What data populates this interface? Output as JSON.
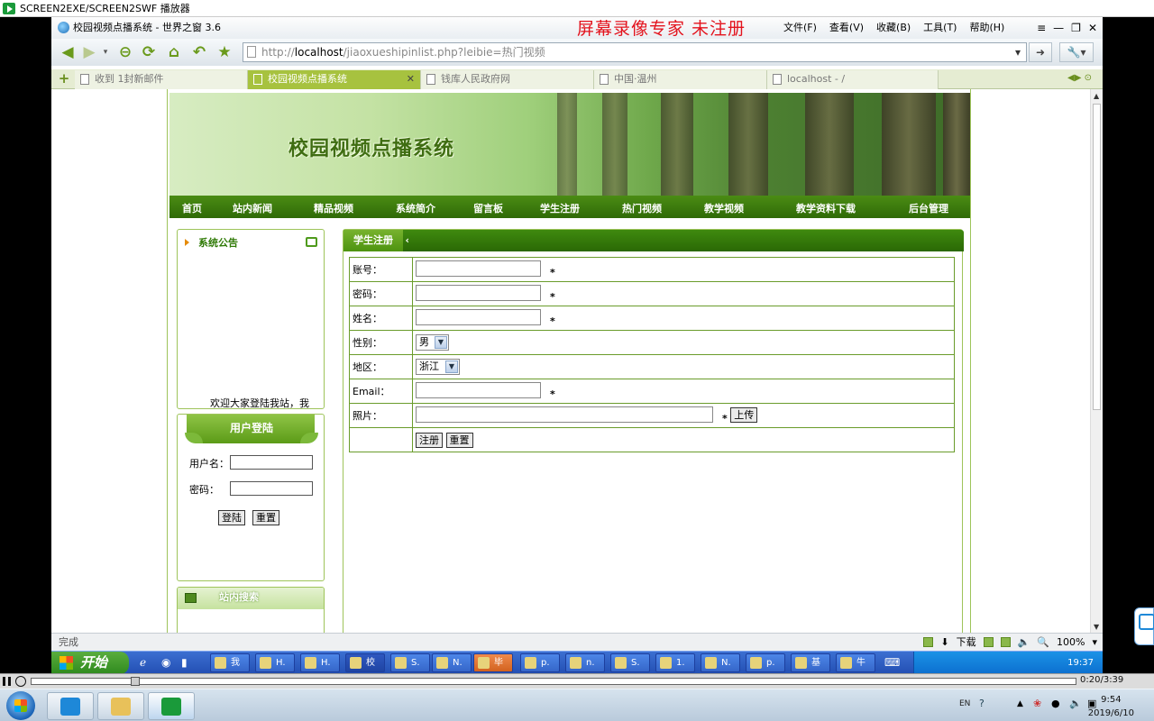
{
  "player": {
    "title": "SCREEN2EXE/SCREEN2SWF 播放器",
    "time": "0:20/3:39"
  },
  "browser": {
    "window_title": "校园视频点播系统 - 世界之窗 3.6",
    "watermark": "屏幕录像专家  未注册",
    "menu": [
      "文件(F)",
      "查看(V)",
      "收藏(B)",
      "工具(T)",
      "帮助(H)"
    ],
    "url_prefix": "http://",
    "url_host": "localhost",
    "url_path": "/jiaoxueshipinlist.php?leibie=热门视频",
    "tabs": [
      {
        "label": "收到 1封新邮件",
        "active": false
      },
      {
        "label": "校园视频点播系统",
        "active": true
      },
      {
        "label": "钱库人民政府网",
        "active": false
      },
      {
        "label": "中国·温州",
        "active": false
      },
      {
        "label": "localhost - /",
        "active": false
      }
    ],
    "status_text": "完成",
    "status_download": "下载",
    "zoom": "100%"
  },
  "site": {
    "title": "校园视频点播系统",
    "nav": [
      "首页",
      "站内新闻",
      "精品视频",
      "系统简介",
      "留言板",
      "学生注册",
      "热门视频",
      "教学视频",
      "教学资料下载",
      "后台管理"
    ],
    "notice": {
      "heading": "系统公告",
      "text": "欢迎大家登陆我站，我"
    },
    "login": {
      "heading": "用户登陆",
      "username_label": "用户名：",
      "password_label": "密码：",
      "submit": "登陆",
      "reset": "重置"
    },
    "search": {
      "heading": "站内搜索"
    },
    "register": {
      "heading": "学生注册",
      "fields": {
        "account": "账号：",
        "password": "密码：",
        "name": "姓名：",
        "gender": "性别：",
        "region": "地区：",
        "email": "Email：",
        "photo": "照片："
      },
      "required_mark": "*",
      "gender_value": "男",
      "region_value": "浙江",
      "upload": "上传",
      "submit": "注册",
      "reset": "重置"
    }
  },
  "taskbar_inner": {
    "start": "开始",
    "items": [
      "我",
      "H.",
      "H.",
      "校",
      "S.",
      "N.",
      "毕",
      "p.",
      "n.",
      "S.",
      "1.",
      "N.",
      "p.",
      "基",
      "牛"
    ],
    "clock": "19:37"
  },
  "taskbar_outer": {
    "lang": "EN",
    "time": "9:54",
    "date": "2019/6/10"
  }
}
